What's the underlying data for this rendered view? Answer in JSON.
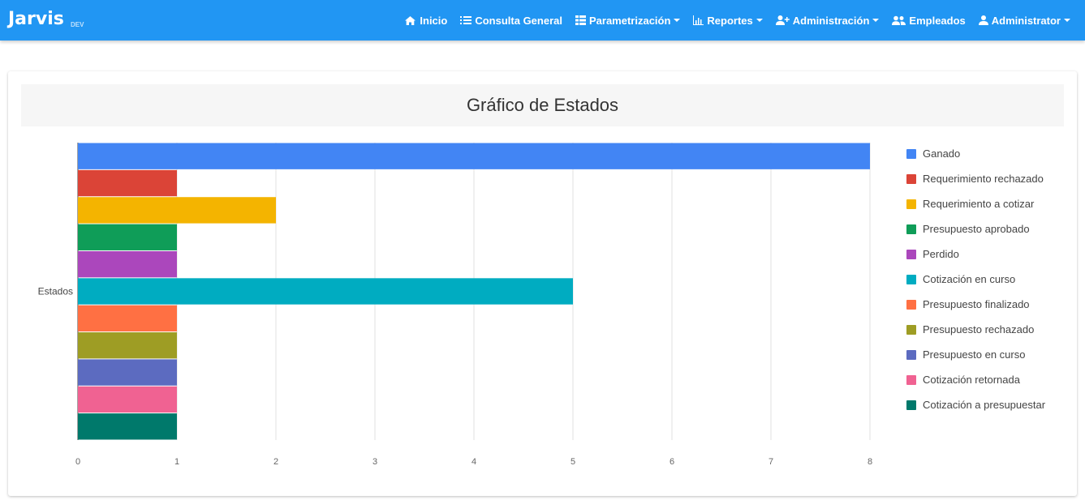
{
  "app": {
    "brand": "Jarvis",
    "env": "DEV"
  },
  "nav": {
    "items": [
      {
        "label": "Inicio",
        "icon": "home-icon",
        "dropdown": false
      },
      {
        "label": "Consulta General",
        "icon": "list-icon",
        "dropdown": false
      },
      {
        "label": "Parametrización",
        "icon": "table-icon",
        "dropdown": true
      },
      {
        "label": "Reportes",
        "icon": "bar-chart-icon",
        "dropdown": true
      },
      {
        "label": "Administración",
        "icon": "user-plus-icon",
        "dropdown": true
      },
      {
        "label": "Empleados",
        "icon": "users-icon",
        "dropdown": false
      },
      {
        "label": "Administrator",
        "icon": "user-icon",
        "dropdown": true
      }
    ]
  },
  "card": {
    "title": "Gráfico de Estados"
  },
  "chart_data": {
    "type": "bar",
    "orientation": "horizontal",
    "categories": [
      "Estados"
    ],
    "series": [
      {
        "name": "Ganado",
        "values": [
          8
        ],
        "color": "#4285f4"
      },
      {
        "name": "Requerimiento rechazado",
        "values": [
          1
        ],
        "color": "#db4437"
      },
      {
        "name": "Requerimiento a cotizar",
        "values": [
          2
        ],
        "color": "#f4b400"
      },
      {
        "name": "Presupuesto aprobado",
        "values": [
          1
        ],
        "color": "#0f9d58"
      },
      {
        "name": "Perdido",
        "values": [
          1
        ],
        "color": "#ab47bc"
      },
      {
        "name": "Cotización en curso",
        "values": [
          5
        ],
        "color": "#00acc1"
      },
      {
        "name": "Presupuesto finalizado",
        "values": [
          1
        ],
        "color": "#ff7043"
      },
      {
        "name": "Presupuesto rechazado",
        "values": [
          1
        ],
        "color": "#9e9d24"
      },
      {
        "name": "Presupuesto en curso",
        "values": [
          1
        ],
        "color": "#5c6bc0"
      },
      {
        "name": "Cotización retornada",
        "values": [
          1
        ],
        "color": "#f06292"
      },
      {
        "name": "Cotización a presupuestar",
        "values": [
          1
        ],
        "color": "#00796b"
      }
    ],
    "xlim": [
      0,
      8
    ],
    "xticks": [
      "0",
      "1",
      "2",
      "3",
      "4",
      "5",
      "6",
      "7",
      "8"
    ],
    "grid": true,
    "legend_position": "right"
  }
}
